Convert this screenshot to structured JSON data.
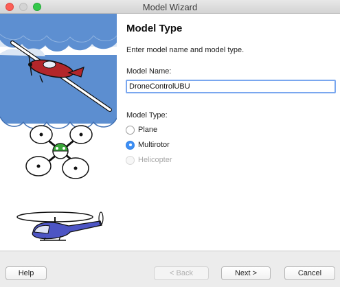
{
  "window": {
    "title": "Model Wizard"
  },
  "page": {
    "heading": "Model Type",
    "description": "Enter model name and model type.",
    "name_label": "Model Name:",
    "name_value": "DroneControlUBU",
    "type_label": "Model Type:",
    "types": [
      {
        "label": "Plane",
        "selected": false,
        "enabled": true
      },
      {
        "label": "Multirotor",
        "selected": true,
        "enabled": true
      },
      {
        "label": "Helicopter",
        "selected": false,
        "enabled": false
      }
    ]
  },
  "footer": {
    "help": "Help",
    "back": "< Back",
    "next": "Next >",
    "cancel": "Cancel"
  },
  "colors": {
    "sky": "#5c8ed0",
    "cloud": "#dbe6f4",
    "plane_body": "#b3262a",
    "drone_dome": "#3aa63a",
    "heli_body": "#4d55c4",
    "accent": "#3d8ff5"
  }
}
